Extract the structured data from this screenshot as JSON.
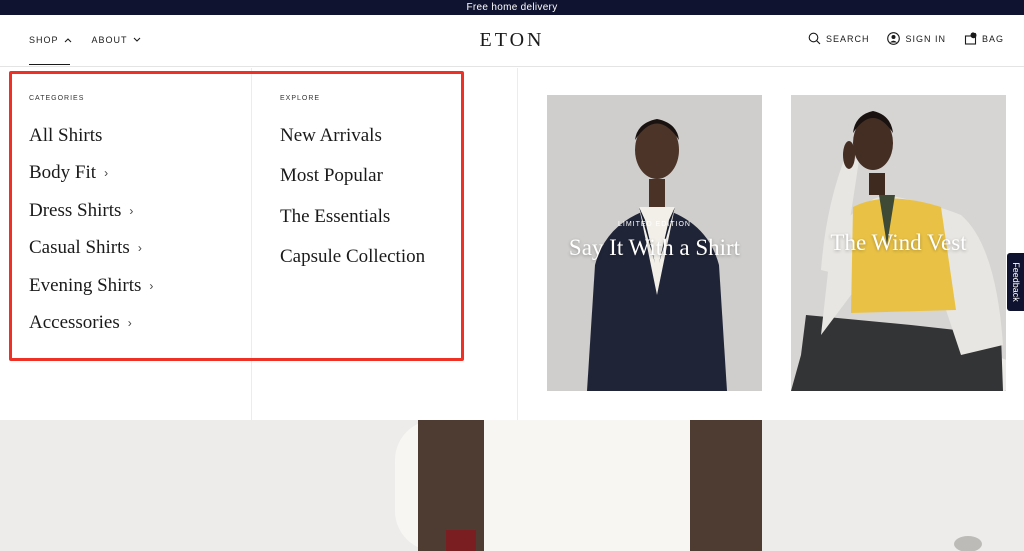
{
  "announcement": "Free home delivery",
  "header": {
    "logo": "ETON",
    "nav_left": [
      {
        "label": "SHOP"
      },
      {
        "label": "ABOUT"
      }
    ],
    "nav_right": {
      "search": "SEARCH",
      "sign_in": "SIGN IN",
      "bag": "BAG",
      "bag_count": "0"
    }
  },
  "mega_menu": {
    "categories_label": "CATEGORIES",
    "categories": [
      {
        "label": "All Shirts",
        "has_submenu": false
      },
      {
        "label": "Body Fit",
        "has_submenu": true
      },
      {
        "label": "Dress Shirts",
        "has_submenu": true
      },
      {
        "label": "Casual Shirts",
        "has_submenu": true
      },
      {
        "label": "Evening Shirts",
        "has_submenu": true
      },
      {
        "label": "Accessories",
        "has_submenu": true
      }
    ],
    "explore_label": "EXPLORE",
    "explore": [
      {
        "label": "New Arrivals"
      },
      {
        "label": "Most Popular"
      },
      {
        "label": "The Essentials"
      },
      {
        "label": "Capsule Collection"
      }
    ],
    "promos": [
      {
        "subtitle": "LIMITED EDITION",
        "title": "Say It With a Shirt"
      },
      {
        "subtitle": "",
        "title": "The Wind Vest"
      }
    ]
  },
  "feedback": "Feedback",
  "colors": {
    "announcement_bg": "#0f1330",
    "highlight_border": "#ef3125"
  }
}
